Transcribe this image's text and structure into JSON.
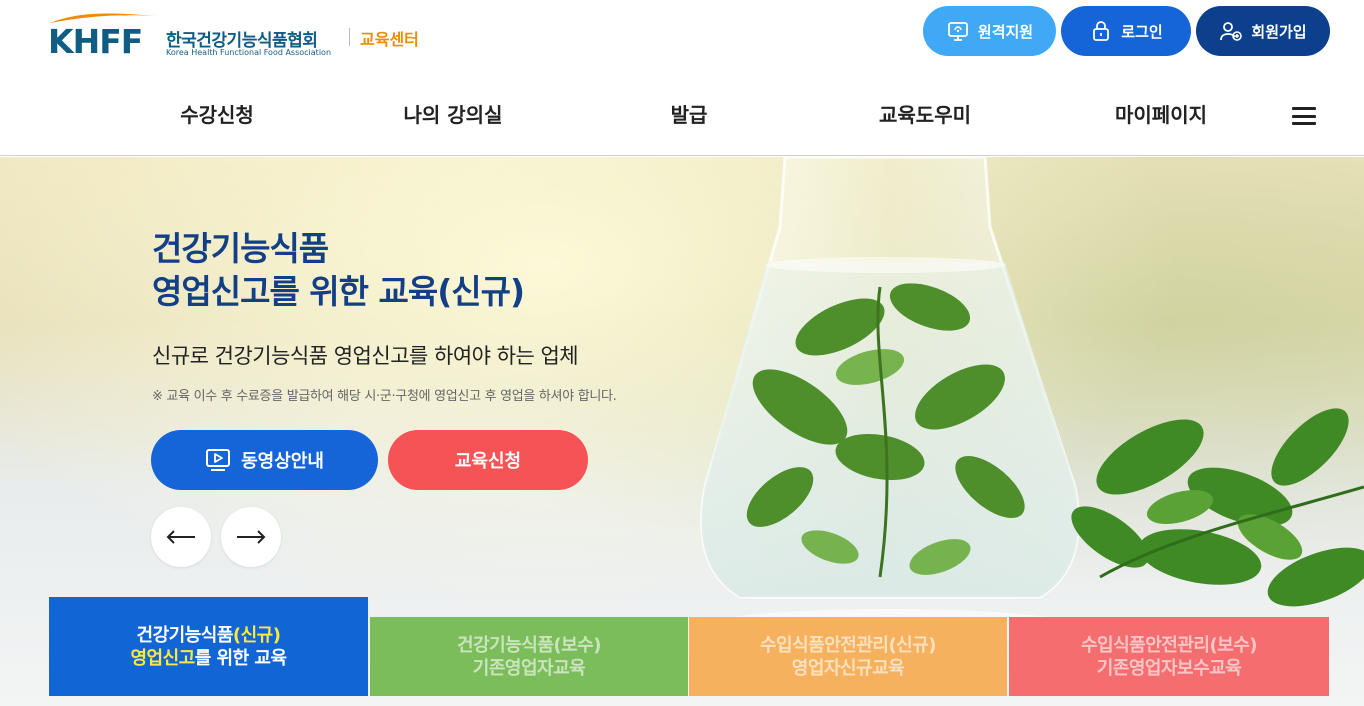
{
  "header": {
    "logo": {
      "mark": "KHFF",
      "korean": "한국건강기능식품협회",
      "english": "Korea Health Functional Food Association",
      "center": "교육센터"
    },
    "buttons": {
      "remote": "원격지원",
      "login": "로그인",
      "join": "회원가입"
    }
  },
  "nav": {
    "items": [
      "수강신청",
      "나의 강의실",
      "발급",
      "교육도우미",
      "마이페이지"
    ]
  },
  "hero": {
    "title_line1": "건강기능식품",
    "title_line2": "영업신고를 위한 교육(신규)",
    "subtitle": "신규로 건강기능식품 영업신고를 하여야 하는 업체",
    "note": "※ 교육 이수 후 수료증을 발급하여 해당 시·군·구청에 영업신고 후 영업을 하셔야 합니다.",
    "video_button": "동영상안내",
    "apply_button": "교육신청",
    "prev_arrow": "←",
    "next_arrow": "→"
  },
  "tabs": [
    {
      "line1_a": "건강기능식품",
      "line1_b": "(신규)",
      "line2_a": "영업신고",
      "line2_b": "를 위한 교육"
    },
    {
      "line1": "건강기능식품(보수)",
      "line2": "기존영업자교육"
    },
    {
      "line1": "수입식품안전관리(신규)",
      "line2": "영업자신규교육"
    },
    {
      "line1": "수입식품안전관리(보수)",
      "line2": "기존영업자보수교육"
    }
  ],
  "colors": {
    "primary": "#1565d8",
    "navy": "#0c3f8c",
    "sky": "#3fa9f5",
    "red": "#f65356",
    "green_tab": "#7bbd5b",
    "orange_tab": "#f6b15e",
    "pink_tab": "#f46e70",
    "highlight": "#ffe93b"
  },
  "icons": [
    "monitor-support-icon",
    "lock-icon",
    "user-add-icon",
    "menu-icon",
    "video-play-icon",
    "arrow-left-icon",
    "arrow-right-icon"
  ]
}
